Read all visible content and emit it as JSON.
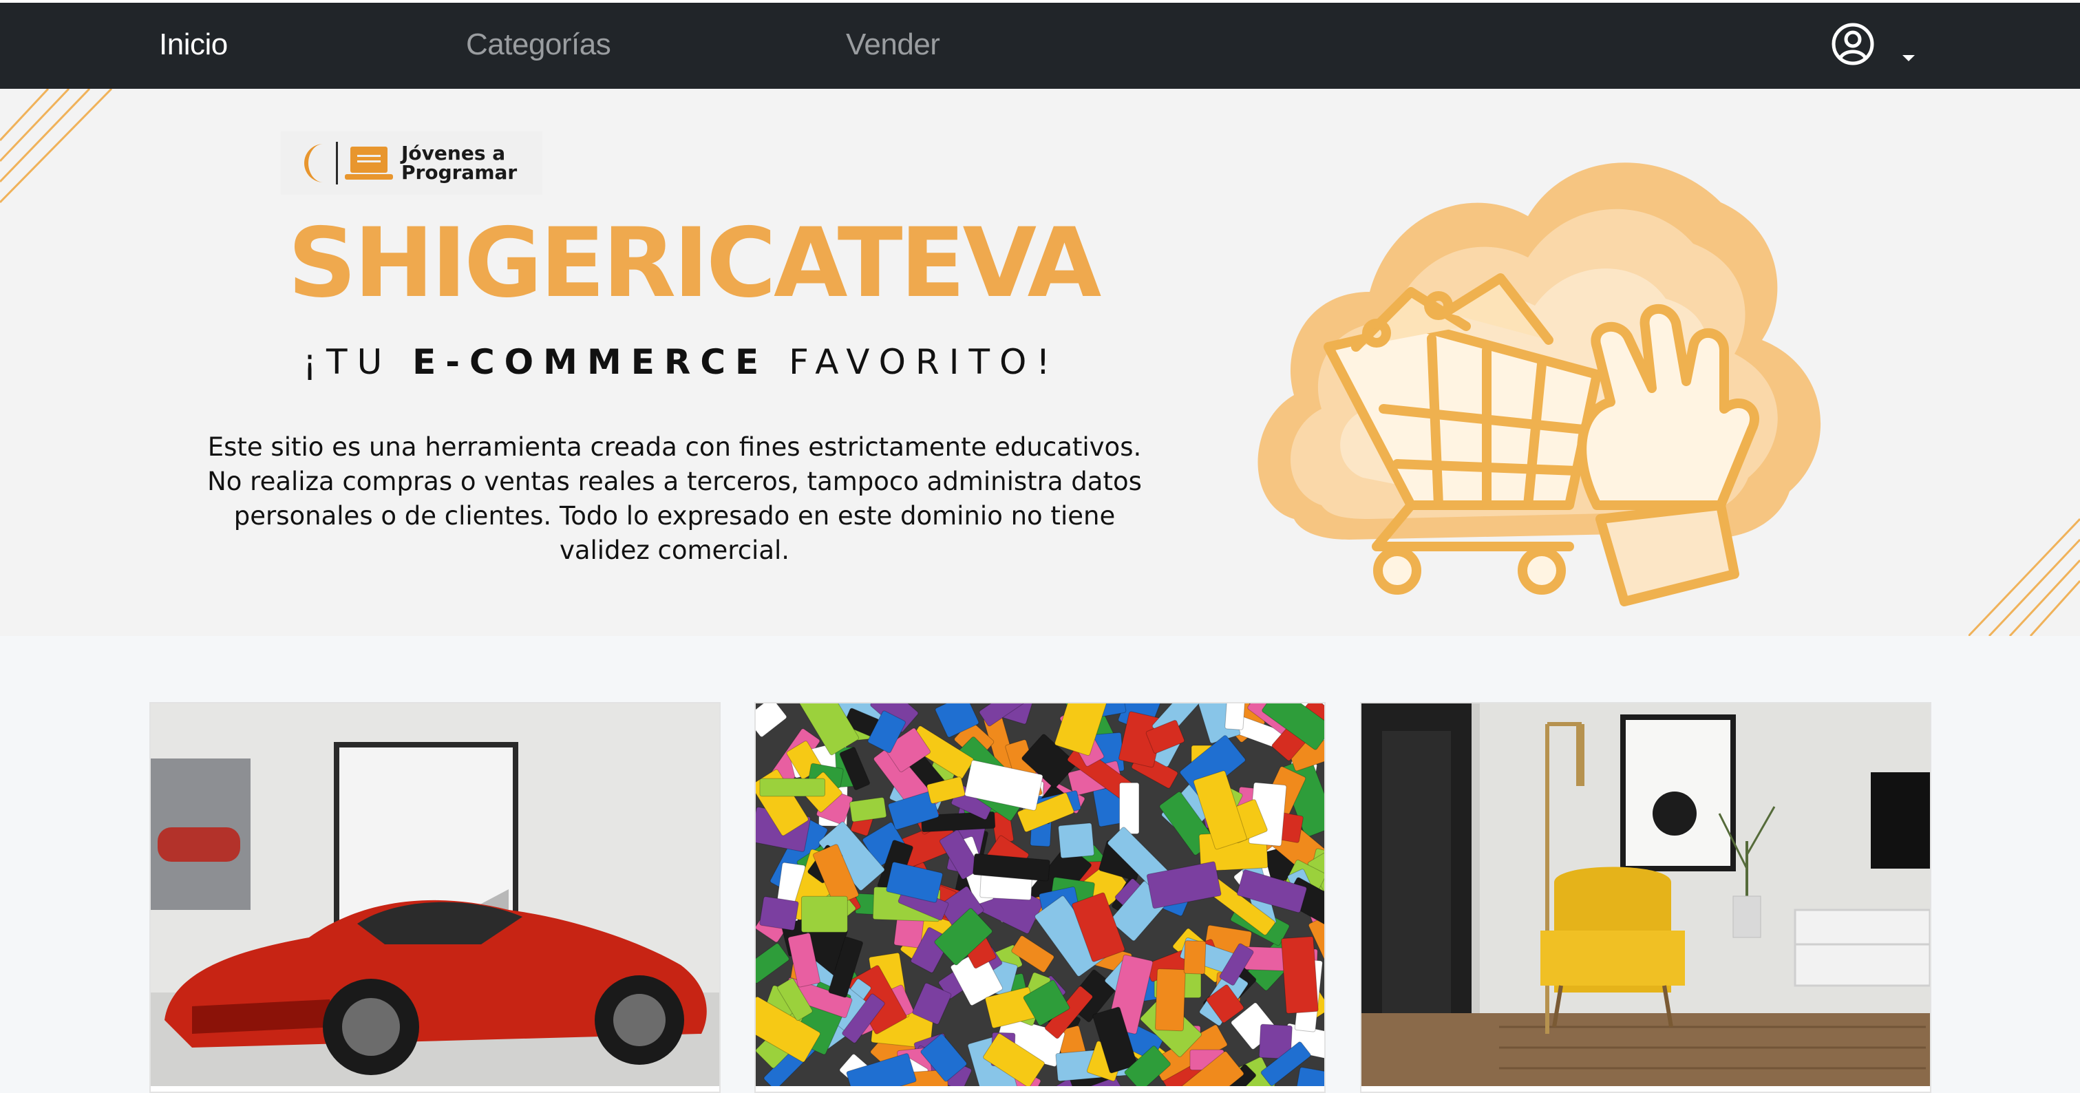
{
  "nav": {
    "links": [
      {
        "label": "Inicio",
        "active": true
      },
      {
        "label": "Categorías",
        "active": false
      },
      {
        "label": "Vender",
        "active": false
      }
    ],
    "user_icon": "user-circle-icon",
    "dropdown_icon": "caret-down-icon"
  },
  "hero": {
    "logo_line1": "Jóvenes a",
    "logo_line2": "Programar",
    "title": "SHIGERICATEVA",
    "subtitle_pre": "¡TU ",
    "subtitle_bold": "E-COMMERCE",
    "subtitle_post": " FAVORITO!",
    "description": "Este sitio es una herramienta creada con fines estrictamente educativos. No realiza compras o ventas reales a terceros, tampoco administra datos personales o de clientes. Todo lo expresado en este dominio no tiene validez comercial.",
    "illustration_icon": "shopping-cart-hand-icon"
  },
  "cards": [
    {
      "image": "red-sports-car-image"
    },
    {
      "image": "lego-bricks-image"
    },
    {
      "image": "yellow-armchair-living-room-image"
    }
  ],
  "colors": {
    "nav_bg": "#212529",
    "accent": "#efa94e",
    "page_bg": "#f5f7f9"
  }
}
